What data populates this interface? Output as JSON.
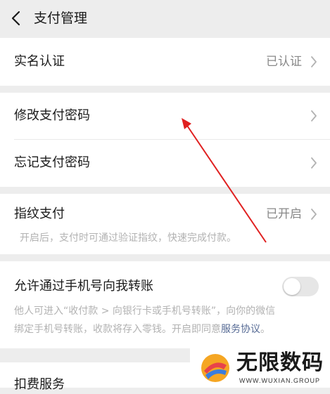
{
  "header": {
    "title": "支付管理",
    "back_icon": "chevron-left-icon"
  },
  "sections": {
    "real_name": {
      "label": "实名认证",
      "value": "已认证"
    },
    "change_password": {
      "label": "修改支付密码"
    },
    "forgot_password": {
      "label": "忘记支付密码"
    },
    "fingerprint": {
      "label": "指纹支付",
      "value": "已开启",
      "description": "开启后，支付时可通过验证指纹，快速完成付款。"
    },
    "phone_transfer": {
      "label": "允许通过手机号向我转账",
      "enabled": false,
      "description_line1": "他人可进入“收付款 > 向银行卡或手机号转账”，向你的微信",
      "description_line2": "绑定手机号转账，收款将存入零钱。开启即同意",
      "link": "服务协议",
      "period": "。"
    },
    "deduction": {
      "label": "扣费服务"
    }
  },
  "annotation": {
    "color": "#e02020"
  },
  "watermark": {
    "title": "无限数码",
    "subtitle": "WWW.WUXIAN.GROUP"
  }
}
